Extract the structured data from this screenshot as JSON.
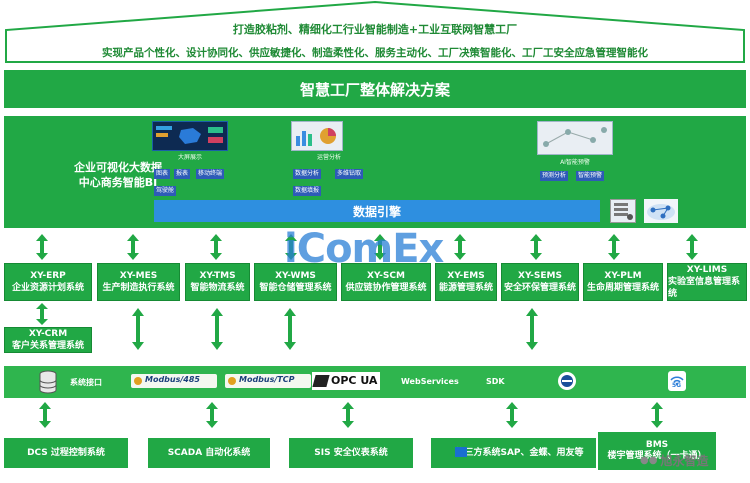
{
  "roof": {
    "line1": "打造胶粘剂、精细化工行业智能制造+工业互联网智慧工厂",
    "line2": "实现产品个性化、设计协同化、供应敏捷化、制造柔性化、服务主动化、工厂决策智能化、工厂工安全应急管理智能化"
  },
  "banner": {
    "title": "智慧工厂整体解决方案"
  },
  "bi": {
    "title": "企业可视化大数据\n中心商务智能BI",
    "dashboards": [
      {
        "caption": "大屏展示",
        "tags": [
          "图表",
          "报表",
          "移动终端",
          "驾驶舱"
        ]
      },
      {
        "caption": "运营分析",
        "tags": [
          "数据分析",
          "多维钻取",
          "数据填报"
        ]
      },
      {
        "caption": "AI智能预警",
        "tags": [
          "预测分析",
          "智能预警"
        ]
      }
    ],
    "engine": "数据引擎"
  },
  "watermark": "iComEx",
  "systems": [
    {
      "code": "XY-ERP",
      "name": "企业资源计划系统"
    },
    {
      "code": "XY-MES",
      "name": "生产制造执行系统"
    },
    {
      "code": "XY-TMS",
      "name": "智能物流系统"
    },
    {
      "code": "XY-WMS",
      "name": "智能仓储管理系统"
    },
    {
      "code": "XY-SCM",
      "name": "供应链协作管理系统"
    },
    {
      "code": "XY-EMS",
      "name": "能源管理系统"
    },
    {
      "code": "XY-SEMS",
      "name": "安全环保管理系统"
    },
    {
      "code": "XY-PLM",
      "name": "生命周期管理系统"
    },
    {
      "code": "XY-LIMS",
      "name": "实验室信息管理系统"
    }
  ],
  "crm": {
    "code": "XY-CRM",
    "name": "客户关系管理系统"
  },
  "interface_bar": {
    "label": "系统接口",
    "modbus485": "Modbus/485",
    "modbustcp": "Modbus/TCP",
    "opcua": "OPC UA",
    "webservices": "WebServices",
    "sdk": "SDK",
    "fiveg": "5G"
  },
  "bottom": [
    {
      "name": "DCS 过程控制系统"
    },
    {
      "name": "SCADA 自动化系统"
    },
    {
      "name": "SIS 安全仪表系统"
    },
    {
      "name": "第三方系统SAP、金蝶、用友等"
    },
    {
      "name": "BMS\n楼宇管理系统（一卡通）"
    }
  ],
  "brand": "旭永智造",
  "colors": {
    "green": "#21a845",
    "blue": "#2e7fd9"
  }
}
